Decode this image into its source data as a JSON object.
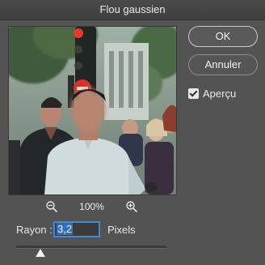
{
  "window": {
    "title": "Flou gaussien"
  },
  "buttons": {
    "ok_label": "OK",
    "cancel_label": "Annuler"
  },
  "preview_toggle": {
    "label": "Aperçu",
    "checked": true
  },
  "zoom": {
    "level": "100%"
  },
  "radius": {
    "label": "Rayon :",
    "value": "3,2",
    "unit": "Pixels"
  },
  "colors": {
    "accent": "#3f8bd6",
    "background": "#535353"
  },
  "icons": {
    "zoom_out": "zoom-out-icon",
    "zoom_in": "zoom-in-icon",
    "slider_thumb": "slider-thumb"
  }
}
